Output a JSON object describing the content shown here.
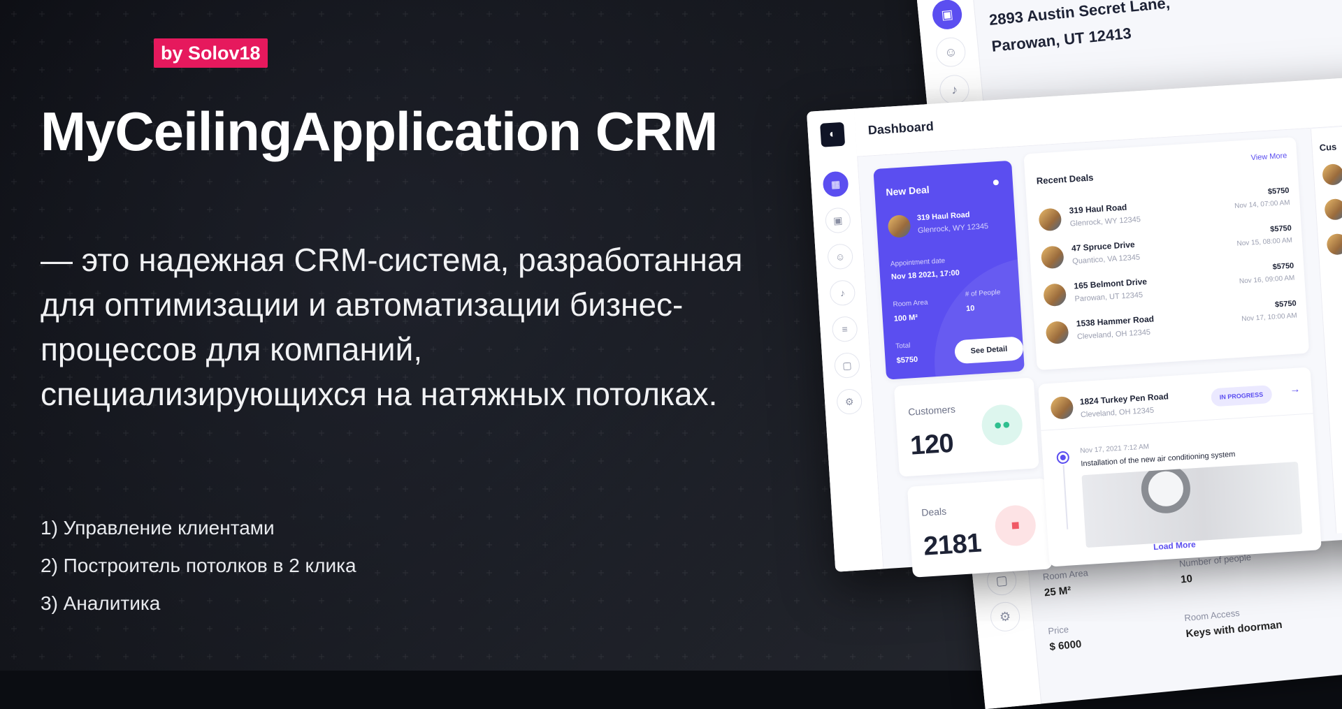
{
  "promo": {
    "badge": "by Solov18",
    "title": "MyCeilingApplication CRM",
    "description": "— это надежная CRM-система, разработанная для оптимизации и автоматизации бизнес-процессов для компаний, специализирующихся на натяжных потолках.",
    "features": [
      "1) Управление клиентами",
      "2) Построитель потолков в 2 клика",
      "3) Аналитика"
    ]
  },
  "back_panel": {
    "address_line1": "2893 Austin Secret Lane,",
    "address_line2": "Parowan, UT 12413",
    "room_area_label": "Room Area",
    "room_area_value": "25 M²",
    "people_label": "Number of people",
    "people_value": "10",
    "price_label": "Price",
    "price_value": "$ 6000",
    "access_label": "Room Access",
    "access_value": "Keys with doorman"
  },
  "dashboard": {
    "title": "Dashboard",
    "new_deal": {
      "title": "New Deal",
      "address": "319 Haul Road",
      "city": "Glenrock, WY 12345",
      "appointment_label": "Appointment date",
      "appointment_value": "Nov 18 2021, 17:00",
      "room_area_label": "Room Area",
      "room_area_value": "100 M²",
      "people_label": "# of People",
      "people_value": "10",
      "total_label": "Total",
      "total_value": "$5750",
      "button": "See Detail"
    },
    "customers": {
      "label": "Customers",
      "value": "120",
      "accent": "#2fbf8f"
    },
    "deals": {
      "label": "Deals",
      "value": "2181",
      "accent": "#f05a66"
    },
    "recent_deals": {
      "title": "Recent Deals",
      "view_more": "View More",
      "rows": [
        {
          "address": "319 Haul Road",
          "city": "Glenrock, WY 12345",
          "price": "$5750",
          "date": "Nov 14, 07:00 AM"
        },
        {
          "address": "47 Spruce Drive",
          "city": "Quantico, VA 12345",
          "price": "$5750",
          "date": "Nov 15, 08:00 AM"
        },
        {
          "address": "165 Belmont Drive",
          "city": "Parowan, UT 12345",
          "price": "$5750",
          "date": "Nov 16, 09:00 AM"
        },
        {
          "address": "1538 Hammer Road",
          "city": "Cleveland, OH 12345",
          "price": "$5750",
          "date": "Nov 17, 10:00 AM"
        }
      ]
    },
    "activity": {
      "address": "1824 Turkey Pen Road",
      "city": "Cleveland, OH 12345",
      "status": "IN PROGRESS",
      "timeline_date": "Nov 17, 2021 7:12 AM",
      "timeline_text": "Installation of the new air conditioning system",
      "load_more": "Load More"
    },
    "side_title": "Cus",
    "accent_color": "#5b4ef0"
  }
}
